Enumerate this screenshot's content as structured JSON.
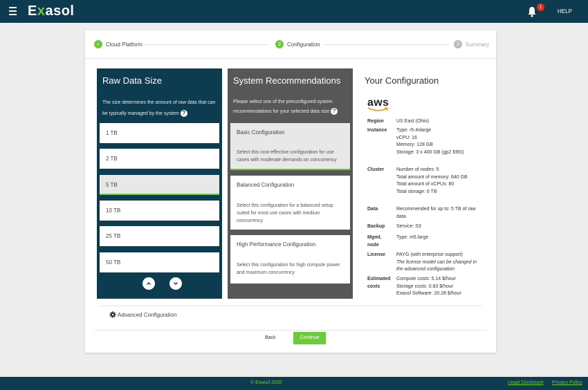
{
  "header": {
    "logo_prefix": "E",
    "logo_x": "x",
    "logo_suffix": "asol",
    "notification_count": "1",
    "help_label": "HELP"
  },
  "stepper": {
    "steps": [
      {
        "number": "✓",
        "label": "Cloud Platform",
        "state": "done"
      },
      {
        "number": "2",
        "label": "Configuration",
        "state": "active"
      },
      {
        "number": "3",
        "label": "Summary",
        "state": "todo"
      }
    ]
  },
  "raw_data": {
    "title": "Raw Data Size",
    "description": "The size determines the amount of raw data that can be typically managed by the system",
    "help_icon": "?",
    "options": [
      "1 TB",
      "2 TB",
      "5 TB",
      "10 TB",
      "25 TB",
      "50 TB"
    ],
    "selected": "5 TB",
    "up_icon": "chevron-up-icon",
    "down_icon": "chevron-down-icon"
  },
  "recommendations": {
    "title": "System Recommendations",
    "description": "Please select one of the preconfigured system recommendations for your selected data size",
    "help_icon": "?",
    "options": [
      {
        "title": "Basic Configuration",
        "text": "Select this cost-effective configuration for use cases with moderate demands on concurrency"
      },
      {
        "title": "Balanced Configuration",
        "text": "Select this configuration for a balanced setup suited for most use cases with medium concurrency"
      },
      {
        "title": "High Performance Configuration",
        "text": "Select this configuration for high compute power and maximum concurrency"
      }
    ],
    "selected": "Basic Configuration"
  },
  "your_config": {
    "title": "Your Configuration",
    "provider": "aws",
    "rows": [
      {
        "label": "Region",
        "lines": [
          "US East (Ohio)"
        ]
      },
      {
        "label": "Instance",
        "lines": [
          "Type: r5.4xlarge",
          "vCPU: 16",
          "Memory: 128 GB",
          "Storage: 3 x 400 GB (gp2 EBS)"
        ]
      },
      {
        "label": "Cluster",
        "lines": [
          "Number of nodes: 5",
          "Total amount of memory: 640 GB",
          "Total amount of vCPUs: 80",
          "Total storage: 6 TB"
        ]
      },
      {
        "label": "Data",
        "lines": [
          "Recommended for up to: 5 TB of raw",
          "data"
        ]
      },
      {
        "label": "Backup",
        "lines": [
          "Service: S3"
        ]
      },
      {
        "label": "Mgmt.",
        "label2": "node",
        "lines": [
          "Type: m5.large"
        ]
      },
      {
        "label": "License",
        "lines": [
          "PAYG (with enterprise support)"
        ],
        "italic_lines": [
          "The license model can be changed in",
          "the advanced configuration"
        ]
      },
      {
        "label": "Estimated",
        "label2": "costs",
        "lines": [
          "Compute costs: 5.14 $/hour",
          "Storage costs: 0.83 $/hour",
          "Exasol Software: 20.28 $/hour"
        ]
      }
    ]
  },
  "advanced": {
    "label": "Advanced Configuration"
  },
  "actions": {
    "back_label": "Back",
    "continue_label": "Continue"
  },
  "footer": {
    "copyright": "© Exasol 2020",
    "legal": "Legal Disclosure",
    "privacy": "Privacy Policy"
  },
  "colors": {
    "primary": "#0d3b4f",
    "accent": "#6fc93c",
    "panel_gray": "#575757"
  }
}
